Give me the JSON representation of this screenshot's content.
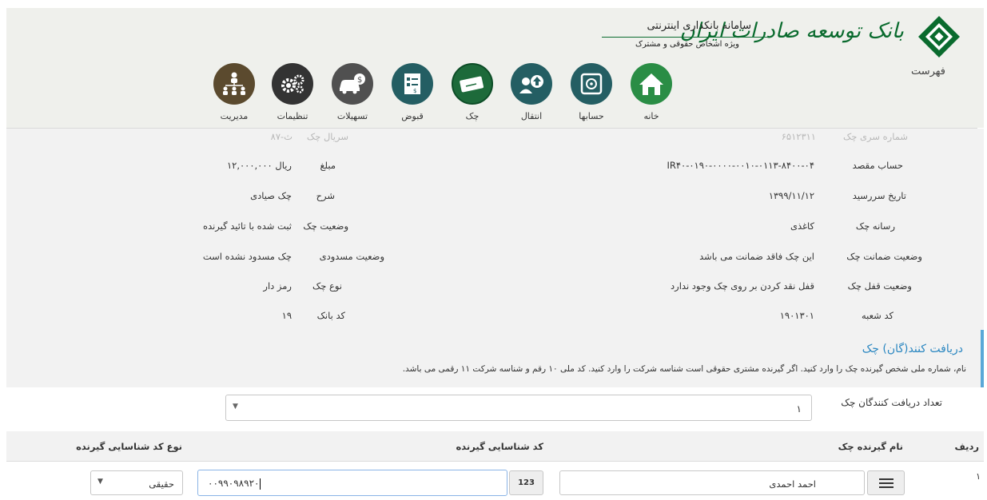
{
  "header": {
    "bank_name": "بانک توسعه صادرات ایران",
    "system_title": "سامانه بانکداری اینترنتی",
    "system_subtitle": "ویژه اشخاص حقوقی و مشترک",
    "menu_label": "فهرست"
  },
  "nav": [
    {
      "label": "خانه",
      "icon": "home-icon"
    },
    {
      "label": "حسابها",
      "icon": "safe-icon"
    },
    {
      "label": "انتقال",
      "icon": "transfer-icon"
    },
    {
      "label": "چک",
      "icon": "cheque-icon"
    },
    {
      "label": "قبوض",
      "icon": "bill-icon"
    },
    {
      "label": "تسهیلات",
      "icon": "car-loan-icon"
    },
    {
      "label": "تنظیمات",
      "icon": "gears-icon"
    },
    {
      "label": "مدیریت",
      "icon": "org-chart-icon"
    }
  ],
  "details": {
    "series_label": "شماره سری چک",
    "series_value": "۶۵۱۲۳۱۱",
    "serial_label": "سریال چک",
    "serial_value": "۸۷-ث",
    "dest_label": "حساب مقصد",
    "dest_value": "IR۴۰-۰۱۹۰-۰۰۰۰-۰۰۱۰-۰۱۱۳-۸۴۰۰-۰۴",
    "amount_label": "مبلغ",
    "amount_value": "۱۲,۰۰۰,۰۰۰ ریال",
    "due_label": "تاریخ سررسید",
    "due_value": "۱۳۹۹/۱۱/۱۲",
    "desc_label": "شرح",
    "desc_value": "چک صیادی",
    "medium_label": "رسانه چک",
    "medium_value": "کاغذی",
    "status_label": "وضعیت چک",
    "status_value": "ثبت شده با تائید گیرنده",
    "guarantee_label": "وضعیت ضمانت چک",
    "guarantee_value": "این چک فاقد ضمانت می باشد",
    "blocked_label": "وضعیت مسدودی",
    "blocked_value": "چک مسدود نشده است",
    "lock_label": "وضعیت قفل چک",
    "lock_value": "قفل نقد کردن بر روی چک وجود ندارد",
    "type_label": "نوع چک",
    "type_value": "رمز دار",
    "branch_label": "کد شعبه",
    "branch_value": "۱۹۰۱۳۰۱",
    "bank_label": "کد بانک",
    "bank_value": "۱۹"
  },
  "receivers": {
    "title": "دریافت کنند(گان) چک",
    "hint": "نام، شماره ملی شخص گیرنده چک را وارد کنید. اگر گیرنده مشتری حقوقی است شناسه شرکت را وارد کنید. کد ملی ۱۰ رقم و شناسه شرکت ۱۱ رقمی می باشد.",
    "count_label": "تعداد دریافت کنندگان چک",
    "count_value": "۱",
    "columns": {
      "row": "ردیف",
      "name": "نام گیرنده چک",
      "id": "کد شناسایی گیرنده",
      "type": "نوع کد شناسایی گیرنده"
    },
    "rows": [
      {
        "index": "۱",
        "name": "احمد احمدی",
        "id_tag": "123",
        "id": "۰۰۹۹۰۹۸۹۲۰",
        "type": "حقیقی"
      }
    ]
  },
  "colors": {
    "brand_green": "#0a6b2e",
    "accent_blue": "#2b87c1"
  }
}
